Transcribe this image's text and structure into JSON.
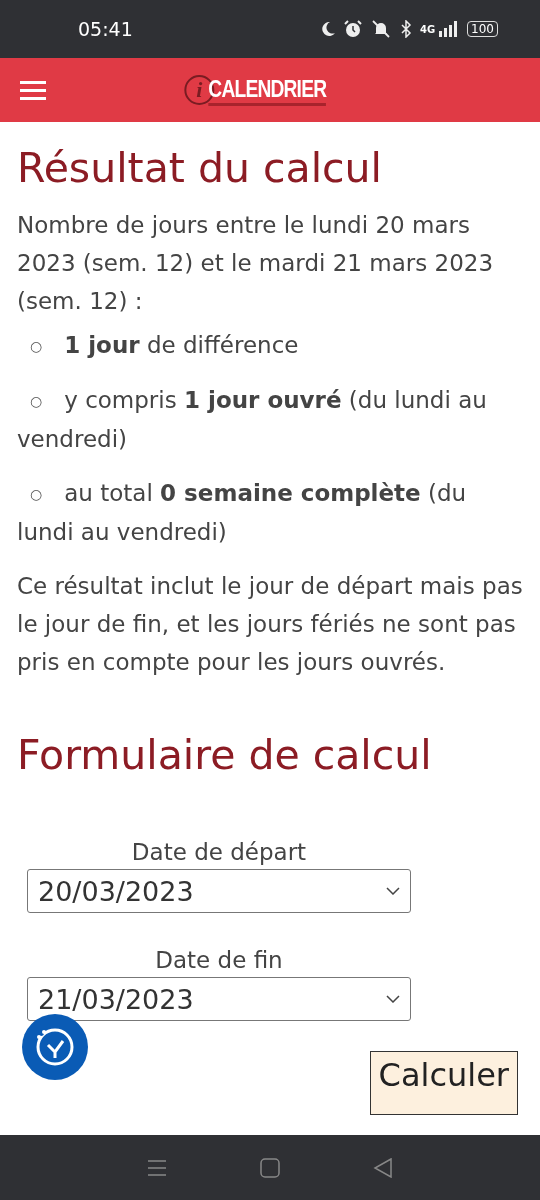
{
  "status_bar": {
    "time": "05:41",
    "network": "4G",
    "battery": "100"
  },
  "header": {
    "logo": {
      "mark": "i",
      "text": "CALENDRIER"
    }
  },
  "result": {
    "title": "Résultat du calcul",
    "intro": "Nombre de jours entre le lundi 20 mars 2023 (sem. 12) et le mardi 21 mars 2023 (sem. 12) :",
    "marker": "○",
    "items": [
      "**1 jour** de différence",
      "y compris **1 jour ouvré** (du lundi au vendredi)",
      "au total **0 semaine complète** (du lundi au vendredi)"
    ],
    "note": "Ce résultat inclut le jour de départ mais pas le jour de fin, et les jours fériés ne sont pas pris en compte pour les jours ouvrés."
  },
  "form": {
    "title": "Formulaire de calcul",
    "fields": [
      {
        "label": "Date de départ",
        "value": "20/03/2023"
      },
      {
        "label": "Date de fin",
        "value": "21/03/2023"
      }
    ],
    "submit": "Calculer"
  }
}
